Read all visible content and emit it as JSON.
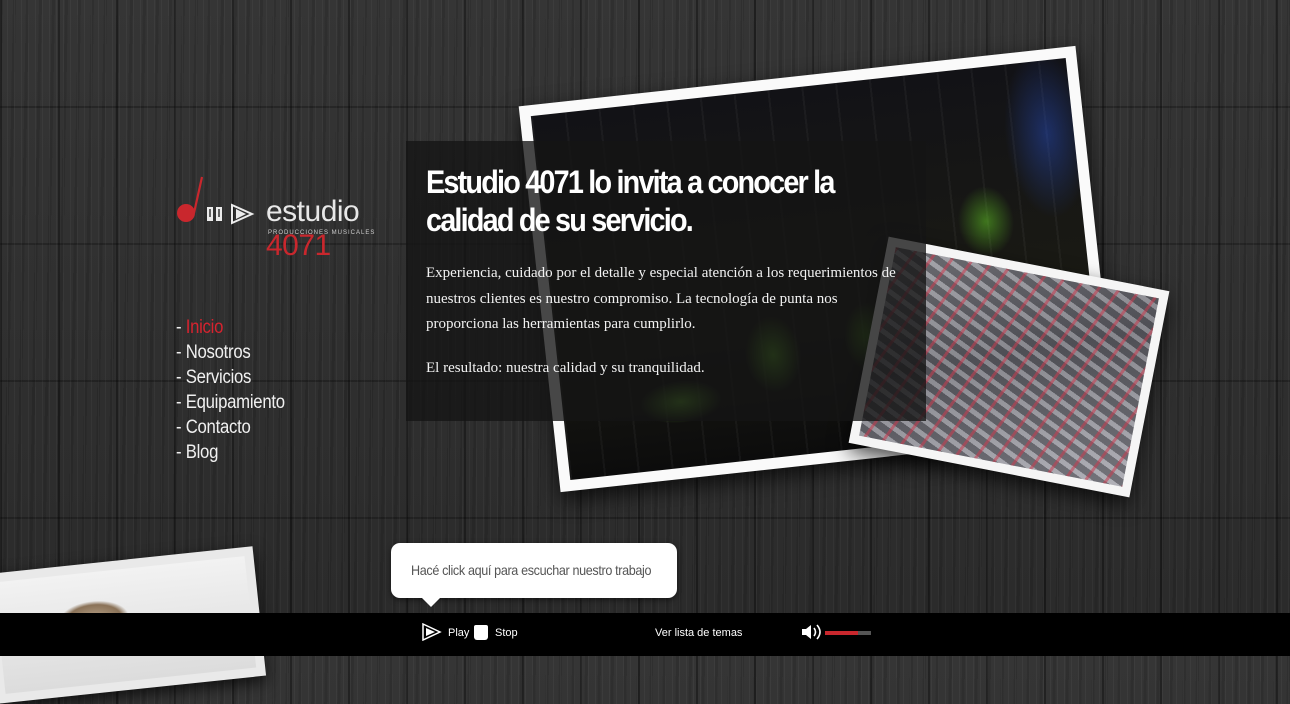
{
  "logo": {
    "wordmark_prefix": "estudio ",
    "wordmark_number": "4071",
    "tagline": "PRODUCCIONES MUSICALES",
    "accent_color": "#c9272d"
  },
  "nav": {
    "items": [
      {
        "prefix": "- ",
        "label": "Inicio",
        "active": true
      },
      {
        "prefix": "- ",
        "label": "Nosotros",
        "active": false
      },
      {
        "prefix": "- ",
        "label": "Servicios",
        "active": false
      },
      {
        "prefix": "- ",
        "label": "Equipamiento",
        "active": false
      },
      {
        "prefix": "- ",
        "label": "Contacto",
        "active": false
      },
      {
        "prefix": "- ",
        "label": "Blog",
        "active": false
      }
    ],
    "active_color": "#d6232f"
  },
  "hero": {
    "headline": "Estudio 4071 lo invita a conocer la calidad de su servicio.",
    "paragraph1": "Experiencia, cuidado por el detalle y especial atención a los requerimientos de nuestros clientes es nuestro compromiso. La tecnología de punta nos proporciona las herramientas para cumplirlo.",
    "paragraph2": "El resultado: nuestra calidad y su tranquilidad."
  },
  "tooltip": {
    "text": "Hacé click aquí para escuchar nuestro trabajo"
  },
  "player": {
    "play_label": "Play",
    "stop_label": "Stop",
    "playlist_label": "Ver lista de temas",
    "play_icon": "play-icon",
    "stop_icon": "stop-icon",
    "volume_icon": "speaker-icon",
    "volume_level": 0.72,
    "volume_color": "#c9272d"
  }
}
